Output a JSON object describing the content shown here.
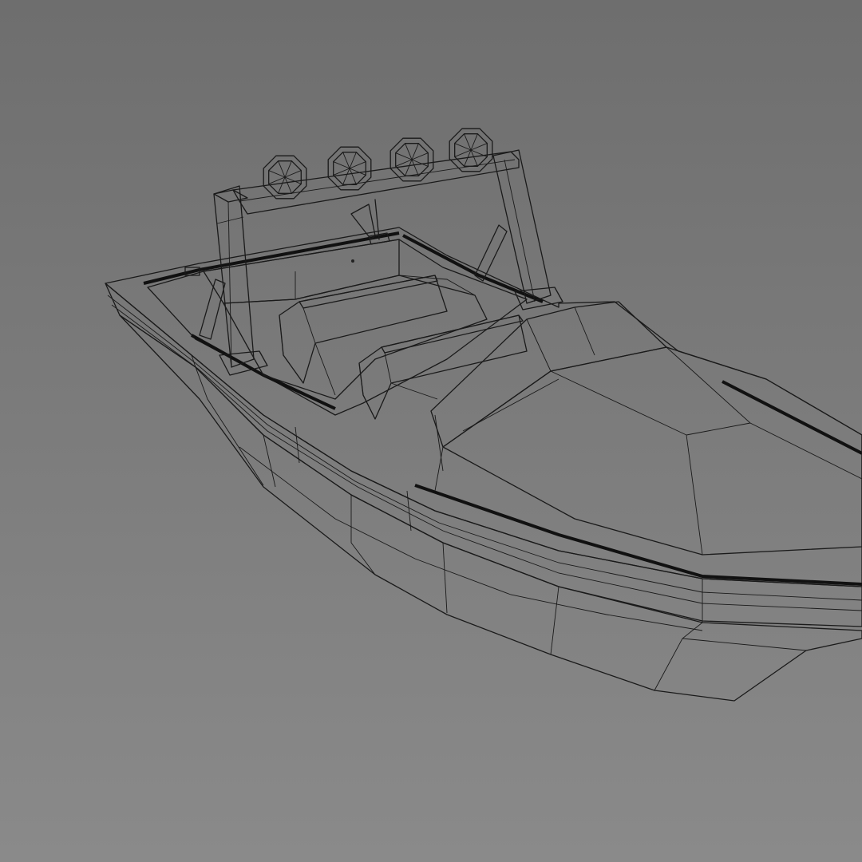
{
  "viewport": {
    "background_top": "#6e6e6e",
    "background_bottom": "#8a8a8a",
    "material_color": "#d6d6d6",
    "material_shadow": "#bdbdbd",
    "wire_color": "#1a1a1a"
  },
  "model": {
    "shading": "clay-wireframe",
    "light_count": 4
  }
}
